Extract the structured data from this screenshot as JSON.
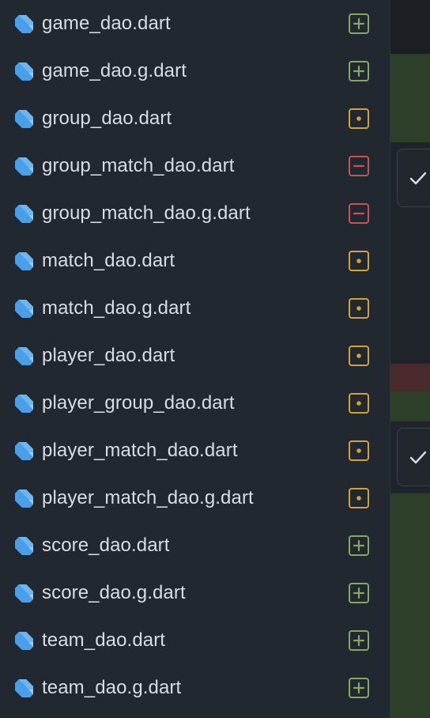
{
  "files": [
    {
      "name": "game_dao.dart",
      "status": "added",
      "icon": "dart-file-icon"
    },
    {
      "name": "game_dao.g.dart",
      "status": "added",
      "icon": "dart-file-icon"
    },
    {
      "name": "group_dao.dart",
      "status": "modified",
      "icon": "dart-file-icon"
    },
    {
      "name": "group_match_dao.dart",
      "status": "deleted",
      "icon": "dart-file-icon"
    },
    {
      "name": "group_match_dao.g.dart",
      "status": "deleted",
      "icon": "dart-file-icon"
    },
    {
      "name": "match_dao.dart",
      "status": "modified",
      "icon": "dart-file-icon"
    },
    {
      "name": "match_dao.g.dart",
      "status": "modified",
      "icon": "dart-file-icon"
    },
    {
      "name": "player_dao.dart",
      "status": "modified",
      "icon": "dart-file-icon"
    },
    {
      "name": "player_group_dao.dart",
      "status": "modified",
      "icon": "dart-file-icon"
    },
    {
      "name": "player_match_dao.dart",
      "status": "modified",
      "icon": "dart-file-icon"
    },
    {
      "name": "player_match_dao.g.dart",
      "status": "modified",
      "icon": "dart-file-icon"
    },
    {
      "name": "score_dao.dart",
      "status": "added",
      "icon": "dart-file-icon"
    },
    {
      "name": "score_dao.g.dart",
      "status": "added",
      "icon": "dart-file-icon"
    },
    {
      "name": "team_dao.dart",
      "status": "added",
      "icon": "dart-file-icon"
    },
    {
      "name": "team_dao.g.dart",
      "status": "added",
      "icon": "dart-file-icon"
    }
  ],
  "colors": {
    "added": "#88a65f",
    "modified": "#d3a03a",
    "deleted": "#c85353",
    "dart_blue": "#4a9fea",
    "dart_light": "#a7d3f5",
    "diff_added_bg": "#2e3f29",
    "diff_deleted_bg": "#4a2a2d"
  },
  "diff_pane": {
    "viewed_checks": [
      "check-icon",
      "check-icon"
    ]
  }
}
